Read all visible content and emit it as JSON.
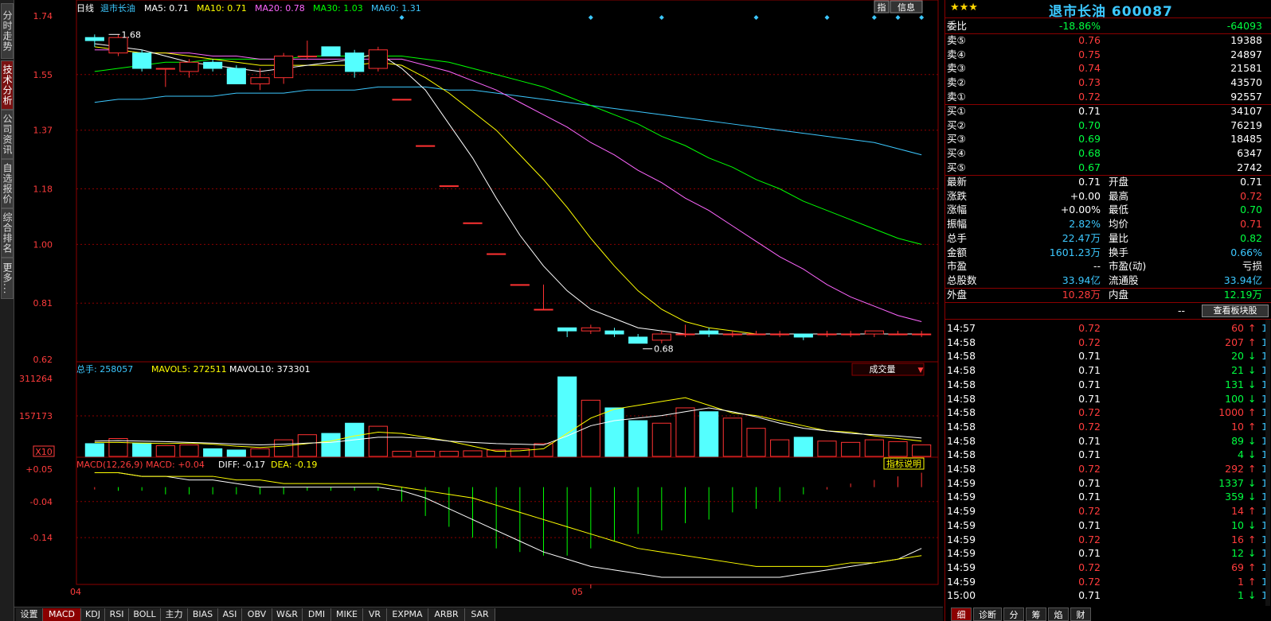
{
  "left_tabs": [
    "分时走势",
    "技术分析",
    "公司资讯",
    "自选报价",
    "综合排名",
    "更多..."
  ],
  "chart": {
    "period": "日线",
    "name": "退市长油",
    "ma": [
      {
        "label": "MA5:",
        "value": "0.71",
        "color": "#ffffff"
      },
      {
        "label": "MA10:",
        "value": "0.71",
        "color": "#ffff00"
      },
      {
        "label": "MA20:",
        "value": "0.78",
        "color": "#ff66ff"
      },
      {
        "label": "MA30:",
        "value": "1.03",
        "color": "#00ff00"
      },
      {
        "label": "MA60:",
        "value": "1.31",
        "color": "#3cc8ff"
      }
    ],
    "buttons": [
      "指",
      "信息"
    ],
    "yticks": [
      "1.74",
      "1.55",
      "1.37",
      "1.18",
      "1.00",
      "0.81",
      "0.62"
    ],
    "high_label": "1.68",
    "low_label": "0.68",
    "vol_header": {
      "label": "总手:",
      "value": "258057",
      "mavol5_label": "MAVOL5:",
      "mavol5": "272511",
      "mavol10_label": "MAVOL10:",
      "mavol10": "373301"
    },
    "vol_dropdown": "成交量",
    "vol_yticks": [
      "311264",
      "157173",
      "X10"
    ],
    "macd_header": {
      "label": "MACD(12,26,9)",
      "macd": "MACD: +0.04",
      "diff": "DIFF: -0.17",
      "dea": "DEA: -0.19"
    },
    "macd_help": "指标说明",
    "macd_yticks": [
      "+0.05",
      "-0.04",
      "-0.14"
    ],
    "x_labels": [
      "04",
      "05"
    ],
    "colors": {
      "up": "#ff3232",
      "down": "#54ffff",
      "grid": "#8b0000",
      "ma5": "#ffffff",
      "ma10": "#ffff00",
      "ma20": "#ff66ff",
      "ma30": "#00ff00",
      "ma60": "#3cc8ff"
    }
  },
  "chart_data": {
    "type": "candlestick",
    "ylim": [
      0.62,
      1.74
    ],
    "candles": [
      {
        "o": 1.67,
        "c": 1.66,
        "h": 1.68,
        "l": 1.64
      },
      {
        "o": 1.62,
        "c": 1.67,
        "h": 1.68,
        "l": 1.61
      },
      {
        "o": 1.62,
        "c": 1.57,
        "h": 1.63,
        "l": 1.56
      },
      {
        "o": 1.57,
        "c": 1.57,
        "h": 1.57,
        "l": 1.51
      },
      {
        "o": 1.56,
        "c": 1.59,
        "h": 1.6,
        "l": 1.54
      },
      {
        "o": 1.59,
        "c": 1.57,
        "h": 1.6,
        "l": 1.56
      },
      {
        "o": 1.57,
        "c": 1.52,
        "h": 1.58,
        "l": 1.52
      },
      {
        "o": 1.52,
        "c": 1.54,
        "h": 1.57,
        "l": 1.5
      },
      {
        "o": 1.54,
        "c": 1.61,
        "h": 1.62,
        "l": 1.52
      },
      {
        "o": 1.61,
        "c": 1.61,
        "h": 1.66,
        "l": 1.6
      },
      {
        "o": 1.64,
        "c": 1.61,
        "h": 1.64,
        "l": 1.61
      },
      {
        "o": 1.62,
        "c": 1.56,
        "h": 1.63,
        "l": 1.54
      },
      {
        "o": 1.57,
        "c": 1.63,
        "h": 1.64,
        "l": 1.56
      },
      {
        "o": 1.47,
        "c": 1.47,
        "h": 1.47,
        "l": 1.47
      },
      {
        "o": 1.32,
        "c": 1.32,
        "h": 1.32,
        "l": 1.32
      },
      {
        "o": 1.19,
        "c": 1.19,
        "h": 1.19,
        "l": 1.19
      },
      {
        "o": 1.07,
        "c": 1.07,
        "h": 1.07,
        "l": 1.07
      },
      {
        "o": 0.97,
        "c": 0.97,
        "h": 0.97,
        "l": 0.97
      },
      {
        "o": 0.87,
        "c": 0.87,
        "h": 0.87,
        "l": 0.87
      },
      {
        "o": 0.79,
        "c": 0.79,
        "h": 0.87,
        "l": 0.79
      },
      {
        "o": 0.73,
        "c": 0.72,
        "h": 0.73,
        "l": 0.7
      },
      {
        "o": 0.72,
        "c": 0.73,
        "h": 0.74,
        "l": 0.71
      },
      {
        "o": 0.72,
        "c": 0.71,
        "h": 0.73,
        "l": 0.7
      },
      {
        "o": 0.7,
        "c": 0.68,
        "h": 0.71,
        "l": 0.68
      },
      {
        "o": 0.69,
        "c": 0.71,
        "h": 0.72,
        "l": 0.68
      },
      {
        "o": 0.71,
        "c": 0.71,
        "h": 0.74,
        "l": 0.7
      },
      {
        "o": 0.72,
        "c": 0.71,
        "h": 0.73,
        "l": 0.7
      },
      {
        "o": 0.71,
        "c": 0.71,
        "h": 0.72,
        "l": 0.7
      },
      {
        "o": 0.71,
        "c": 0.71,
        "h": 0.72,
        "l": 0.71
      },
      {
        "o": 0.71,
        "c": 0.71,
        "h": 0.72,
        "l": 0.7
      },
      {
        "o": 0.71,
        "c": 0.7,
        "h": 0.71,
        "l": 0.69
      },
      {
        "o": 0.71,
        "c": 0.71,
        "h": 0.72,
        "l": 0.7
      },
      {
        "o": 0.71,
        "c": 0.71,
        "h": 0.72,
        "l": 0.7
      },
      {
        "o": 0.71,
        "c": 0.72,
        "h": 0.72,
        "l": 0.7
      },
      {
        "o": 0.71,
        "c": 0.71,
        "h": 0.72,
        "l": 0.71
      },
      {
        "o": 0.71,
        "c": 0.71,
        "h": 0.72,
        "l": 0.7
      }
    ],
    "ma_series": {
      "ma5": [
        1.65,
        1.64,
        1.63,
        1.61,
        1.59,
        1.58,
        1.57,
        1.56,
        1.57,
        1.58,
        1.59,
        1.6,
        1.62,
        1.57,
        1.5,
        1.39,
        1.28,
        1.15,
        1.03,
        0.93,
        0.85,
        0.79,
        0.76,
        0.73,
        0.72,
        0.71,
        0.71,
        0.71,
        0.71,
        0.71,
        0.71,
        0.71,
        0.71,
        0.71,
        0.71,
        0.71
      ],
      "ma10": [
        1.64,
        1.63,
        1.62,
        1.62,
        1.61,
        1.6,
        1.59,
        1.58,
        1.58,
        1.58,
        1.58,
        1.58,
        1.59,
        1.58,
        1.54,
        1.49,
        1.43,
        1.37,
        1.29,
        1.21,
        1.12,
        1.02,
        0.93,
        0.85,
        0.79,
        0.75,
        0.73,
        0.72,
        0.71,
        0.71,
        0.71,
        0.71,
        0.71,
        0.71,
        0.71,
        0.71
      ],
      "ma20": [
        1.63,
        1.63,
        1.62,
        1.62,
        1.62,
        1.61,
        1.61,
        1.6,
        1.6,
        1.6,
        1.6,
        1.6,
        1.6,
        1.6,
        1.58,
        1.56,
        1.53,
        1.5,
        1.46,
        1.42,
        1.38,
        1.33,
        1.29,
        1.24,
        1.2,
        1.15,
        1.11,
        1.06,
        1.01,
        0.96,
        0.92,
        0.87,
        0.83,
        0.8,
        0.77,
        0.75
      ],
      "ma30": [
        1.56,
        1.57,
        1.58,
        1.59,
        1.59,
        1.6,
        1.6,
        1.6,
        1.6,
        1.61,
        1.61,
        1.61,
        1.61,
        1.61,
        1.6,
        1.59,
        1.57,
        1.55,
        1.53,
        1.51,
        1.48,
        1.45,
        1.42,
        1.39,
        1.35,
        1.32,
        1.28,
        1.25,
        1.21,
        1.18,
        1.14,
        1.11,
        1.08,
        1.05,
        1.02,
        1.0
      ],
      "ma60": [
        1.46,
        1.47,
        1.47,
        1.48,
        1.48,
        1.48,
        1.49,
        1.49,
        1.49,
        1.5,
        1.5,
        1.5,
        1.51,
        1.51,
        1.51,
        1.5,
        1.5,
        1.49,
        1.48,
        1.47,
        1.46,
        1.45,
        1.44,
        1.43,
        1.42,
        1.41,
        1.4,
        1.39,
        1.38,
        1.37,
        1.36,
        1.35,
        1.34,
        1.33,
        1.31,
        1.29
      ]
    },
    "volume": [
      50000,
      70000,
      52000,
      42000,
      45000,
      30000,
      25000,
      30000,
      65000,
      85000,
      90000,
      130000,
      118000,
      20000,
      20000,
      20000,
      22000,
      25000,
      30000,
      50000,
      311264,
      220000,
      190000,
      140000,
      130000,
      190000,
      175000,
      150000,
      110000,
      65000,
      75000,
      60000,
      55000,
      65000,
      58000,
      45000
    ],
    "mavol5": [
      55000,
      55000,
      52000,
      50000,
      52000,
      48000,
      40000,
      35000,
      40000,
      50000,
      60000,
      80000,
      95000,
      90000,
      75000,
      60000,
      40000,
      20000,
      22000,
      30000,
      90000,
      150000,
      185000,
      200000,
      215000,
      230000,
      200000,
      170000,
      160000,
      140000,
      120000,
      100000,
      95000,
      80000,
      70000,
      60000
    ],
    "mavol10": [
      60000,
      62000,
      60000,
      58000,
      55000,
      52000,
      48000,
      45000,
      48000,
      52000,
      55000,
      65000,
      75000,
      75000,
      70000,
      60000,
      55000,
      50000,
      48000,
      45000,
      80000,
      120000,
      140000,
      150000,
      160000,
      175000,
      190000,
      175000,
      155000,
      130000,
      110000,
      100000,
      90000,
      85000,
      80000,
      72000
    ],
    "macd_hist": [
      0.0,
      -0.01,
      -0.01,
      -0.02,
      -0.02,
      -0.02,
      -0.02,
      -0.02,
      -0.02,
      -0.01,
      -0.01,
      -0.01,
      -0.01,
      -0.04,
      -0.08,
      -0.11,
      -0.14,
      -0.17,
      -0.18,
      -0.19,
      -0.19,
      -0.17,
      -0.15,
      -0.13,
      -0.12,
      -0.1,
      -0.09,
      -0.07,
      -0.06,
      -0.04,
      -0.02,
      0.0,
      0.01,
      0.02,
      0.03,
      0.04
    ],
    "diff": [
      0.04,
      0.04,
      0.03,
      0.03,
      0.02,
      0.02,
      0.01,
      0.0,
      0.0,
      0.0,
      0.0,
      0.0,
      0.0,
      -0.01,
      -0.03,
      -0.06,
      -0.09,
      -0.12,
      -0.15,
      -0.18,
      -0.2,
      -0.22,
      -0.23,
      -0.24,
      -0.25,
      -0.25,
      -0.25,
      -0.25,
      -0.25,
      -0.25,
      -0.24,
      -0.23,
      -0.22,
      -0.21,
      -0.2,
      -0.17
    ],
    "dea": [
      0.04,
      0.04,
      0.03,
      0.03,
      0.03,
      0.03,
      0.02,
      0.02,
      0.01,
      0.01,
      0.01,
      0.01,
      0.01,
      0.0,
      -0.01,
      -0.02,
      -0.03,
      -0.05,
      -0.07,
      -0.09,
      -0.11,
      -0.13,
      -0.15,
      -0.17,
      -0.18,
      -0.19,
      -0.2,
      -0.21,
      -0.22,
      -0.22,
      -0.22,
      -0.22,
      -0.21,
      -0.21,
      -0.2,
      -0.19
    ]
  },
  "bottom_tabs": [
    "设置",
    "MACD",
    "KDJ",
    "RSI",
    "BOLL",
    "主力",
    "BIAS",
    "ASI",
    "OBV",
    "W&R",
    "DMI",
    "MIKE",
    "VR",
    "EXPMA",
    "ARBR",
    "SAR"
  ],
  "quote": {
    "stars": "★★★",
    "title": "退市长油 600087",
    "weibi": {
      "label": "委比",
      "pct": "-18.86%",
      "diff": "-64093"
    },
    "sell": [
      {
        "label": "卖⑤",
        "price": "0.76",
        "vol": "19388"
      },
      {
        "label": "卖④",
        "price": "0.75",
        "vol": "24897"
      },
      {
        "label": "卖③",
        "price": "0.74",
        "vol": "21581"
      },
      {
        "label": "卖②",
        "price": "0.73",
        "vol": "43570"
      },
      {
        "label": "卖①",
        "price": "0.72",
        "vol": "92557"
      }
    ],
    "buy": [
      {
        "label": "买①",
        "price": "0.71",
        "vol": "34107"
      },
      {
        "label": "买②",
        "price": "0.70",
        "vol": "76219"
      },
      {
        "label": "买③",
        "price": "0.69",
        "vol": "18485"
      },
      {
        "label": "买④",
        "price": "0.68",
        "vol": "6347"
      },
      {
        "label": "买⑤",
        "price": "0.67",
        "vol": "2742"
      }
    ],
    "stats": [
      {
        "l1": "最新",
        "v1": "0.71",
        "c1": "wht",
        "l2": "开盘",
        "v2": "0.71",
        "c2": "wht"
      },
      {
        "l1": "涨跌",
        "v1": "+0.00",
        "c1": "wht",
        "l2": "最高",
        "v2": "0.72",
        "c2": "red"
      },
      {
        "l1": "涨幅",
        "v1": "+0.00%",
        "c1": "wht",
        "l2": "最低",
        "v2": "0.70",
        "c2": "grn"
      },
      {
        "l1": "振幅",
        "v1": "2.82%",
        "c1": "cyn",
        "l2": "均价",
        "v2": "0.71",
        "c2": "red"
      },
      {
        "l1": "总手",
        "v1": "22.47万",
        "c1": "cyn",
        "l2": "量比",
        "v2": "0.82",
        "c2": "grn"
      },
      {
        "l1": "金额",
        "v1": "1601.23万",
        "c1": "cyn",
        "l2": "换手",
        "v2": "0.66%",
        "c2": "cyn"
      },
      {
        "l1": "市盈",
        "v1": "--",
        "c1": "wht",
        "l2": "市盈(动)",
        "v2": "亏损",
        "c2": "wht"
      },
      {
        "l1": "总股数",
        "v1": "33.94亿",
        "c1": "cyn",
        "l2": "流通股",
        "v2": "33.94亿",
        "c2": "cyn"
      }
    ],
    "outer": {
      "l1": "外盘",
      "v1": "10.28万",
      "l2": "内盘",
      "v2": "12.19万"
    },
    "block_btn": "查看板块股",
    "dashes": "--",
    "ticks": [
      {
        "t": "14:57",
        "p": "0.72",
        "pc": "red",
        "v": "60",
        "dir": "up",
        "n": "1"
      },
      {
        "t": "14:58",
        "p": "0.72",
        "pc": "red",
        "v": "207",
        "dir": "up",
        "n": "1"
      },
      {
        "t": "14:58",
        "p": "0.71",
        "pc": "wht",
        "v": "20",
        "dir": "down",
        "n": "1"
      },
      {
        "t": "14:58",
        "p": "0.71",
        "pc": "wht",
        "v": "21",
        "dir": "down",
        "n": "1"
      },
      {
        "t": "14:58",
        "p": "0.71",
        "pc": "wht",
        "v": "131",
        "dir": "down",
        "n": "1"
      },
      {
        "t": "14:58",
        "p": "0.71",
        "pc": "wht",
        "v": "100",
        "dir": "down",
        "n": "1"
      },
      {
        "t": "14:58",
        "p": "0.72",
        "pc": "red",
        "v": "1000",
        "dir": "up",
        "n": "1"
      },
      {
        "t": "14:58",
        "p": "0.72",
        "pc": "red",
        "v": "10",
        "dir": "up",
        "n": "1"
      },
      {
        "t": "14:58",
        "p": "0.71",
        "pc": "wht",
        "v": "89",
        "dir": "down",
        "n": "1"
      },
      {
        "t": "14:58",
        "p": "0.71",
        "pc": "wht",
        "v": "4",
        "dir": "down",
        "n": "1"
      },
      {
        "t": "14:58",
        "p": "0.72",
        "pc": "red",
        "v": "292",
        "dir": "up",
        "n": "1"
      },
      {
        "t": "14:59",
        "p": "0.71",
        "pc": "wht",
        "v": "1337",
        "dir": "down",
        "n": "1"
      },
      {
        "t": "14:59",
        "p": "0.71",
        "pc": "wht",
        "v": "359",
        "dir": "down",
        "n": "1"
      },
      {
        "t": "14:59",
        "p": "0.72",
        "pc": "red",
        "v": "14",
        "dir": "up",
        "n": "1"
      },
      {
        "t": "14:59",
        "p": "0.71",
        "pc": "wht",
        "v": "10",
        "dir": "down",
        "n": "1"
      },
      {
        "t": "14:59",
        "p": "0.72",
        "pc": "red",
        "v": "16",
        "dir": "up",
        "n": "1"
      },
      {
        "t": "14:59",
        "p": "0.71",
        "pc": "wht",
        "v": "12",
        "dir": "down",
        "n": "1"
      },
      {
        "t": "14:59",
        "p": "0.72",
        "pc": "red",
        "v": "69",
        "dir": "up",
        "n": "1"
      },
      {
        "t": "14:59",
        "p": "0.72",
        "pc": "red",
        "v": "1",
        "dir": "up",
        "n": "1"
      },
      {
        "t": "15:00",
        "p": "0.71",
        "pc": "wht",
        "v": "1",
        "dir": "down",
        "n": "1"
      }
    ],
    "bottom_tabs": [
      "细",
      "诊断",
      "分",
      "筹",
      "焰",
      "财"
    ]
  }
}
